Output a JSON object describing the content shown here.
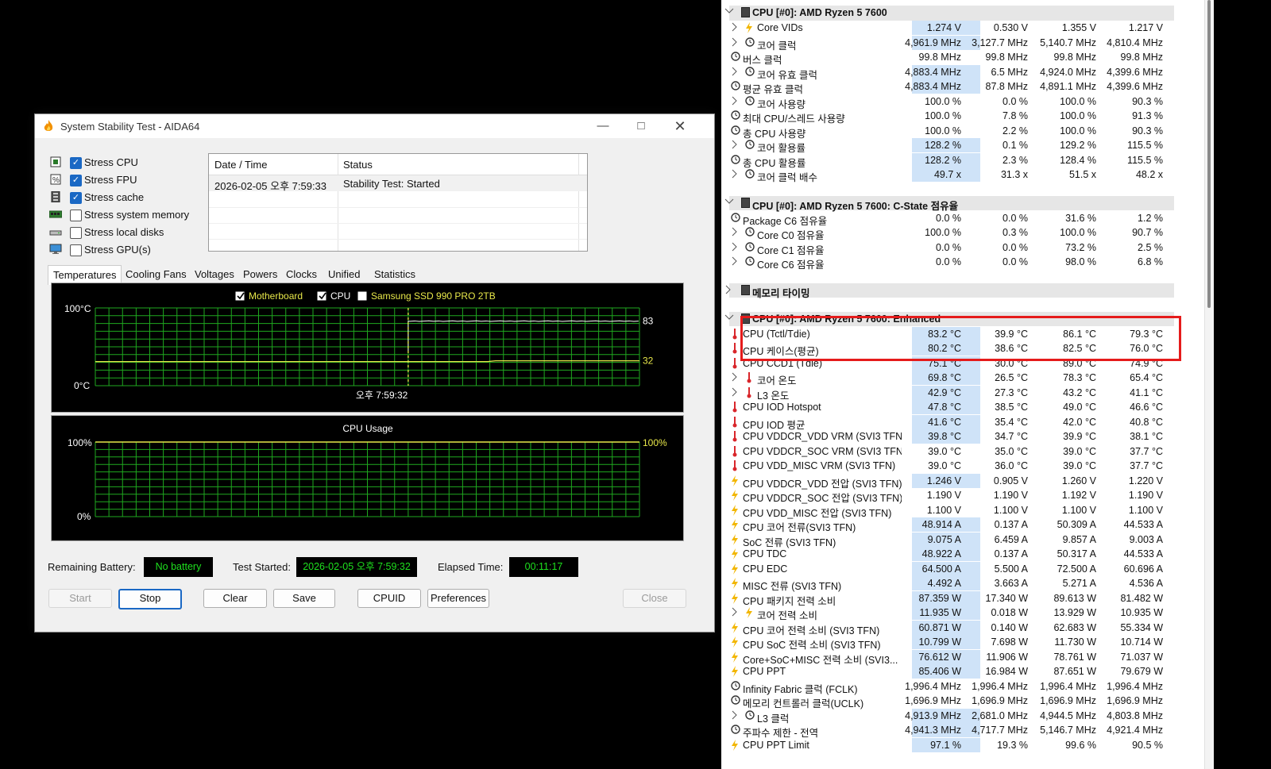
{
  "aida": {
    "title": "System Stability Test - AIDA64",
    "stress_options": [
      {
        "label": "Stress CPU",
        "checked": true,
        "icon": "cpu-chip-icon"
      },
      {
        "label": "Stress FPU",
        "checked": true,
        "icon": "fpu-percent-icon"
      },
      {
        "label": "Stress cache",
        "checked": true,
        "icon": "cache-icon"
      },
      {
        "label": "Stress system memory",
        "checked": false,
        "icon": "memory-icon"
      },
      {
        "label": "Stress local disks",
        "checked": false,
        "icon": "disk-icon"
      },
      {
        "label": "Stress GPU(s)",
        "checked": false,
        "icon": "monitor-icon"
      }
    ],
    "log": {
      "col_datetime": "Date / Time",
      "col_status": "Status",
      "rows": [
        {
          "datetime": "2026-02-05 오후 7:59:33",
          "status": "Stability Test: Started"
        }
      ]
    },
    "tabs": [
      "Temperatures",
      "Cooling Fans",
      "Voltages",
      "Powers",
      "Clocks",
      "Unified",
      "Statistics"
    ],
    "active_tab": "Temperatures",
    "temp_chart": {
      "legend": [
        {
          "label": "Motherboard",
          "checked": true,
          "color": "#e8e84a"
        },
        {
          "label": "CPU",
          "checked": true,
          "color": "#ffffff"
        },
        {
          "label": "Samsung SSD 990 PRO 2TB",
          "checked": false,
          "color": "#e8e84a"
        }
      ],
      "ymax_label": "100°C",
      "ymin_label": "0°C",
      "time_label": "오후 7:59:32",
      "cpu_value_label": "83",
      "mb_value_label": "32"
    },
    "usage_chart": {
      "title": "CPU Usage",
      "ymax_label": "100%",
      "ymin_label": "0%",
      "value_label": "100%"
    },
    "footer": {
      "battery_label": "Remaining Battery:",
      "battery_value": "No battery",
      "started_label": "Test Started:",
      "started_value": "2026-02-05 오후 7:59:32",
      "elapsed_label": "Elapsed Time:",
      "elapsed_value": "00:11:17"
    },
    "buttons": {
      "start": "Start",
      "stop": "Stop",
      "clear": "Clear",
      "save": "Save",
      "cpuid": "CPUID",
      "preferences": "Preferences",
      "close": "Close"
    }
  },
  "chart_data": [
    {
      "type": "line",
      "title": "",
      "ylim": [
        0,
        100
      ],
      "yunit": "°C",
      "series": [
        {
          "name": "CPU",
          "before_start": 44,
          "after_start": 83
        },
        {
          "name": "Motherboard",
          "before_start": 31,
          "after_start": 32
        }
      ],
      "start_marker_label": "오후 7:59:32"
    },
    {
      "type": "line",
      "title": "CPU Usage",
      "ylim": [
        0,
        100
      ],
      "yunit": "%",
      "series": [
        {
          "name": "CPU Usage",
          "value": 100
        }
      ]
    }
  ],
  "hwinfo": {
    "rows": [
      {
        "t": "head",
        "name": "CPU [#0]: AMD Ryzen 5 7600",
        "exp": "v"
      },
      {
        "t": "row",
        "exp": ">",
        "ic": "bolt",
        "ind": 1,
        "name": "Core VIDs",
        "v": [
          "1.274 V",
          "0.530 V",
          "1.355 V",
          "1.217 V"
        ],
        "hl": true
      },
      {
        "t": "row",
        "exp": ">",
        "ic": "clock",
        "ind": 1,
        "name": "코어 클럭",
        "v": [
          "4,961.9 MHz",
          "3,127.7 MHz",
          "5,140.7 MHz",
          "4,810.4 MHz"
        ],
        "hl": true
      },
      {
        "t": "row",
        "ic": "clock",
        "ind": 0,
        "name": "버스 클럭",
        "v": [
          "99.8 MHz",
          "99.8 MHz",
          "99.8 MHz",
          "99.8 MHz"
        ]
      },
      {
        "t": "row",
        "exp": ">",
        "ic": "clock",
        "ind": 1,
        "name": "코어 유효 클럭",
        "v": [
          "4,883.4 MHz",
          "6.5 MHz",
          "4,924.0 MHz",
          "4,399.6 MHz"
        ],
        "hl": true
      },
      {
        "t": "row",
        "ic": "clock",
        "ind": 0,
        "name": "평균 유효 클럭",
        "v": [
          "4,883.4 MHz",
          "87.8 MHz",
          "4,891.1 MHz",
          "4,399.6 MHz"
        ],
        "hl": true
      },
      {
        "t": "row",
        "exp": ">",
        "ic": "clock",
        "ind": 1,
        "name": "코어 사용량",
        "v": [
          "100.0 %",
          "0.0 %",
          "100.0 %",
          "90.3 %"
        ]
      },
      {
        "t": "row",
        "ic": "clock",
        "ind": 0,
        "name": "최대 CPU/스레드 사용량",
        "v": [
          "100.0 %",
          "7.8 %",
          "100.0 %",
          "91.3 %"
        ]
      },
      {
        "t": "row",
        "ic": "clock",
        "ind": 0,
        "name": "총 CPU 사용량",
        "v": [
          "100.0 %",
          "2.2 %",
          "100.0 %",
          "90.3 %"
        ]
      },
      {
        "t": "row",
        "exp": ">",
        "ic": "clock",
        "ind": 1,
        "name": "코어 활용률",
        "v": [
          "128.2 %",
          "0.1 %",
          "129.2 %",
          "115.5 %"
        ],
        "hl": true
      },
      {
        "t": "row",
        "ic": "clock",
        "ind": 0,
        "name": "총 CPU 활용률",
        "v": [
          "128.2 %",
          "2.3 %",
          "128.4 %",
          "115.5 %"
        ],
        "hl": true
      },
      {
        "t": "row",
        "exp": ">",
        "ic": "clock",
        "ind": 1,
        "name": "코어 클럭 배수",
        "v": [
          "49.7 x",
          "31.3 x",
          "51.5 x",
          "48.2 x"
        ],
        "hl": true
      },
      {
        "t": "gap"
      },
      {
        "t": "head",
        "name": "CPU [#0]: AMD Ryzen 5 7600: C-State 점유율",
        "exp": "v"
      },
      {
        "t": "row",
        "ic": "clock",
        "ind": 0,
        "name": "Package C6 점유율",
        "v": [
          "0.0 %",
          "0.0 %",
          "31.6 %",
          "1.2 %"
        ]
      },
      {
        "t": "row",
        "exp": ">",
        "ic": "clock",
        "ind": 1,
        "name": "Core C0 점유율",
        "v": [
          "100.0 %",
          "0.3 %",
          "100.0 %",
          "90.7 %"
        ]
      },
      {
        "t": "row",
        "exp": ">",
        "ic": "clock",
        "ind": 1,
        "name": "Core C1 점유율",
        "v": [
          "0.0 %",
          "0.0 %",
          "73.2 %",
          "2.5 %"
        ]
      },
      {
        "t": "row",
        "exp": ">",
        "ic": "clock",
        "ind": 1,
        "name": "Core C6 점유율",
        "v": [
          "0.0 %",
          "0.0 %",
          "98.0 %",
          "6.8 %"
        ]
      },
      {
        "t": "gap"
      },
      {
        "t": "head",
        "name": "메모리 타이밍",
        "exp": ">"
      },
      {
        "t": "gap"
      },
      {
        "t": "head",
        "name": "CPU [#0]: AMD Ryzen 5 7600: Enhanced",
        "exp": "v"
      },
      {
        "t": "row",
        "ic": "therm",
        "ind": 0,
        "name": "CPU (Tctl/Tdie)",
        "v": [
          "83.2 °C",
          "39.9 °C",
          "86.1 °C",
          "79.3 °C"
        ],
        "hl": true
      },
      {
        "t": "row",
        "ic": "therm",
        "ind": 0,
        "name": "CPU 케이스(평균)",
        "v": [
          "80.2 °C",
          "38.6 °C",
          "82.5 °C",
          "76.0 °C"
        ],
        "hl": true
      },
      {
        "t": "row",
        "ic": "therm",
        "ind": 0,
        "name": "CPU CCD1 (Tdie)",
        "v": [
          "75.1 °C",
          "30.0 °C",
          "89.0 °C",
          "74.9 °C"
        ],
        "hl": true
      },
      {
        "t": "row",
        "exp": ">",
        "ic": "therm",
        "ind": 1,
        "name": "코어 온도",
        "v": [
          "69.8 °C",
          "26.5 °C",
          "78.3 °C",
          "65.4 °C"
        ],
        "hl": true
      },
      {
        "t": "row",
        "exp": ">",
        "ic": "therm",
        "ind": 1,
        "name": "L3 온도",
        "v": [
          "42.9 °C",
          "27.3 °C",
          "43.2 °C",
          "41.1 °C"
        ],
        "hl": true
      },
      {
        "t": "row",
        "ic": "therm",
        "ind": 0,
        "name": "CPU IOD Hotspot",
        "v": [
          "47.8 °C",
          "38.5 °C",
          "49.0 °C",
          "46.6 °C"
        ],
        "hl": true
      },
      {
        "t": "row",
        "ic": "therm",
        "ind": 0,
        "name": "CPU IOD 평균",
        "v": [
          "41.6 °C",
          "35.4 °C",
          "42.0 °C",
          "40.8 °C"
        ],
        "hl": true
      },
      {
        "t": "row",
        "ic": "therm",
        "ind": 0,
        "name": "CPU VDDCR_VDD VRM (SVI3 TFN)",
        "v": [
          "39.8 °C",
          "34.7 °C",
          "39.9 °C",
          "38.1 °C"
        ],
        "hl": true
      },
      {
        "t": "row",
        "ic": "therm",
        "ind": 0,
        "name": "CPU VDDCR_SOC VRM (SVI3 TFN)",
        "v": [
          "39.0 °C",
          "35.0 °C",
          "39.0 °C",
          "37.7 °C"
        ]
      },
      {
        "t": "row",
        "ic": "therm",
        "ind": 0,
        "name": "CPU VDD_MISC VRM (SVI3 TFN)",
        "v": [
          "39.0 °C",
          "36.0 °C",
          "39.0 °C",
          "37.7 °C"
        ]
      },
      {
        "t": "row",
        "ic": "bolt",
        "ind": 0,
        "name": "CPU VDDCR_VDD 전압 (SVI3 TFN)",
        "v": [
          "1.246 V",
          "0.905 V",
          "1.260 V",
          "1.220 V"
        ],
        "hl": true
      },
      {
        "t": "row",
        "ic": "bolt",
        "ind": 0,
        "name": "CPU VDDCR_SOC 전압 (SVI3 TFN)",
        "v": [
          "1.190 V",
          "1.190 V",
          "1.192 V",
          "1.190 V"
        ]
      },
      {
        "t": "row",
        "ic": "bolt",
        "ind": 0,
        "name": "CPU VDD_MISC 전압 (SVI3 TFN)",
        "v": [
          "1.100 V",
          "1.100 V",
          "1.100 V",
          "1.100 V"
        ]
      },
      {
        "t": "row",
        "ic": "bolt",
        "ind": 0,
        "name": "CPU 코어 전류(SVI3 TFN)",
        "v": [
          "48.914 A",
          "0.137 A",
          "50.309 A",
          "44.533 A"
        ],
        "hl": true
      },
      {
        "t": "row",
        "ic": "bolt",
        "ind": 0,
        "name": "SoC 전류 (SVI3 TFN)",
        "v": [
          "9.075 A",
          "6.459 A",
          "9.857 A",
          "9.003 A"
        ],
        "hl": true
      },
      {
        "t": "row",
        "ic": "bolt",
        "ind": 0,
        "name": "CPU TDC",
        "v": [
          "48.922 A",
          "0.137 A",
          "50.317 A",
          "44.533 A"
        ],
        "hl": true
      },
      {
        "t": "row",
        "ic": "bolt",
        "ind": 0,
        "name": "CPU EDC",
        "v": [
          "64.500 A",
          "5.500 A",
          "72.500 A",
          "60.696 A"
        ],
        "hl": true
      },
      {
        "t": "row",
        "ic": "bolt",
        "ind": 0,
        "name": "MISC 전류 (SVI3 TFN)",
        "v": [
          "4.492 A",
          "3.663 A",
          "5.271 A",
          "4.536 A"
        ],
        "hl": true
      },
      {
        "t": "row",
        "ic": "bolt",
        "ind": 0,
        "name": "CPU 패키지 전력 소비",
        "v": [
          "87.359 W",
          "17.340 W",
          "89.613 W",
          "81.482 W"
        ],
        "hl": true
      },
      {
        "t": "row",
        "exp": ">",
        "ic": "bolt",
        "ind": 1,
        "name": "코어 전력 소비",
        "v": [
          "11.935 W",
          "0.018 W",
          "13.929 W",
          "10.935 W"
        ],
        "hl": true
      },
      {
        "t": "row",
        "ic": "bolt",
        "ind": 0,
        "name": "CPU 코어 전력 소비 (SVI3 TFN)",
        "v": [
          "60.871 W",
          "0.140 W",
          "62.683 W",
          "55.334 W"
        ],
        "hl": true
      },
      {
        "t": "row",
        "ic": "bolt",
        "ind": 0,
        "name": "CPU SoC 전력 소비 (SVI3 TFN)",
        "v": [
          "10.799 W",
          "7.698 W",
          "11.730 W",
          "10.714 W"
        ],
        "hl": true
      },
      {
        "t": "row",
        "ic": "bolt",
        "ind": 0,
        "name": "Core+SoC+MISC 전력 소비 (SVI3...",
        "v": [
          "76.612 W",
          "11.906 W",
          "78.761 W",
          "71.037 W"
        ],
        "hl": true
      },
      {
        "t": "row",
        "ic": "bolt",
        "ind": 0,
        "name": "CPU PPT",
        "v": [
          "85.406 W",
          "16.984 W",
          "87.651 W",
          "79.679 W"
        ],
        "hl": true
      },
      {
        "t": "row",
        "ic": "clock",
        "ind": 0,
        "name": "Infinity Fabric 클럭 (FCLK)",
        "v": [
          "1,996.4 MHz",
          "1,996.4 MHz",
          "1,996.4 MHz",
          "1,996.4 MHz"
        ]
      },
      {
        "t": "row",
        "ic": "clock",
        "ind": 0,
        "name": "메모리 컨트롤러 클럭(UCLK)",
        "v": [
          "1,696.9 MHz",
          "1,696.9 MHz",
          "1,696.9 MHz",
          "1,696.9 MHz"
        ]
      },
      {
        "t": "row",
        "exp": ">",
        "ic": "clock",
        "ind": 1,
        "name": "L3 클럭",
        "v": [
          "4,913.9 MHz",
          "2,681.0 MHz",
          "4,944.5 MHz",
          "4,803.8 MHz"
        ],
        "hl": true
      },
      {
        "t": "row",
        "ic": "clock",
        "ind": 0,
        "name": "주파수 제한 - 전역",
        "v": [
          "4,941.3 MHz",
          "4,717.7 MHz",
          "5,146.7 MHz",
          "4,921.4 MHz"
        ],
        "hl": true
      },
      {
        "t": "row",
        "ic": "bolt",
        "ind": 0,
        "name": "CPU PPT Limit",
        "v": [
          "97.1 %",
          "19.3 %",
          "99.6 %",
          "90.5 %"
        ],
        "hl": true
      }
    ]
  },
  "colors": {
    "grid": "#1fa81f",
    "cpu_line": "#ffffff",
    "mb_line": "#e8e84a",
    "highlight": "#e51b1b",
    "cur_bg": "#cfe3f8",
    "bolt": "#f2b600",
    "therm": "#d9262b"
  }
}
